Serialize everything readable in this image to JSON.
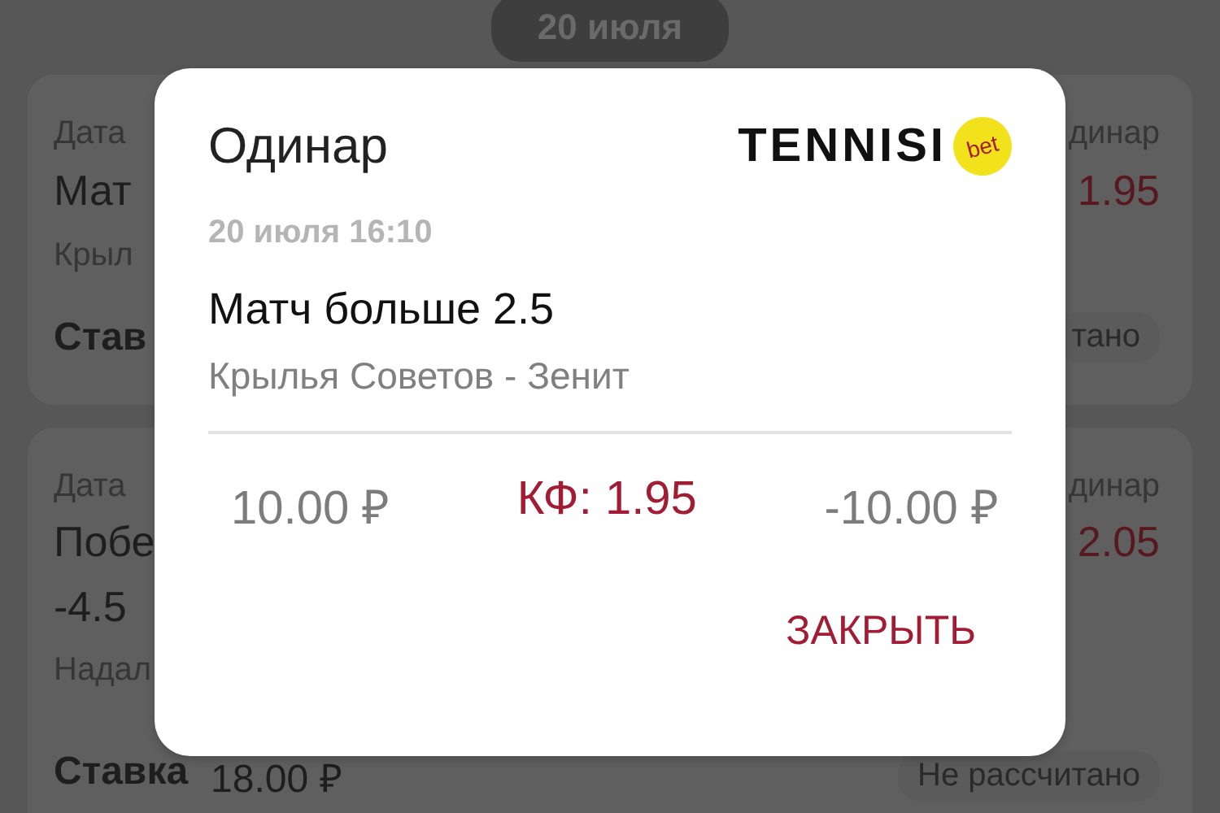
{
  "background": {
    "date_chip": "20 июля",
    "cards": [
      {
        "date_label": "Дата",
        "bet_type": "динар",
        "title_lines": [
          "Мат"
        ],
        "odds": "1.95",
        "subtitle": "Крыл",
        "stake_label": "Став",
        "status": "тано"
      },
      {
        "date_label": "Дата",
        "bet_type": "динар",
        "title_lines": [
          "Побе",
          "-4.5"
        ],
        "odds": "2.05",
        "subtitle": "Надал",
        "stake_label": "Ставка",
        "stake_amount": "18.00 ₽",
        "status": "Не рассчитано"
      }
    ]
  },
  "dialog": {
    "title": "Одинар",
    "logo": {
      "wordmark": "TENNISI",
      "badge": "bet"
    },
    "datetime": "20 июля 16:10",
    "bet_name": "Матч больше 2.5",
    "event": "Крылья Советов - Зенит",
    "stake": "10.00 ₽",
    "odds": "КФ: 1.95",
    "result": "-10.00 ₽",
    "close_button": "ЗАКРЫТЬ"
  }
}
